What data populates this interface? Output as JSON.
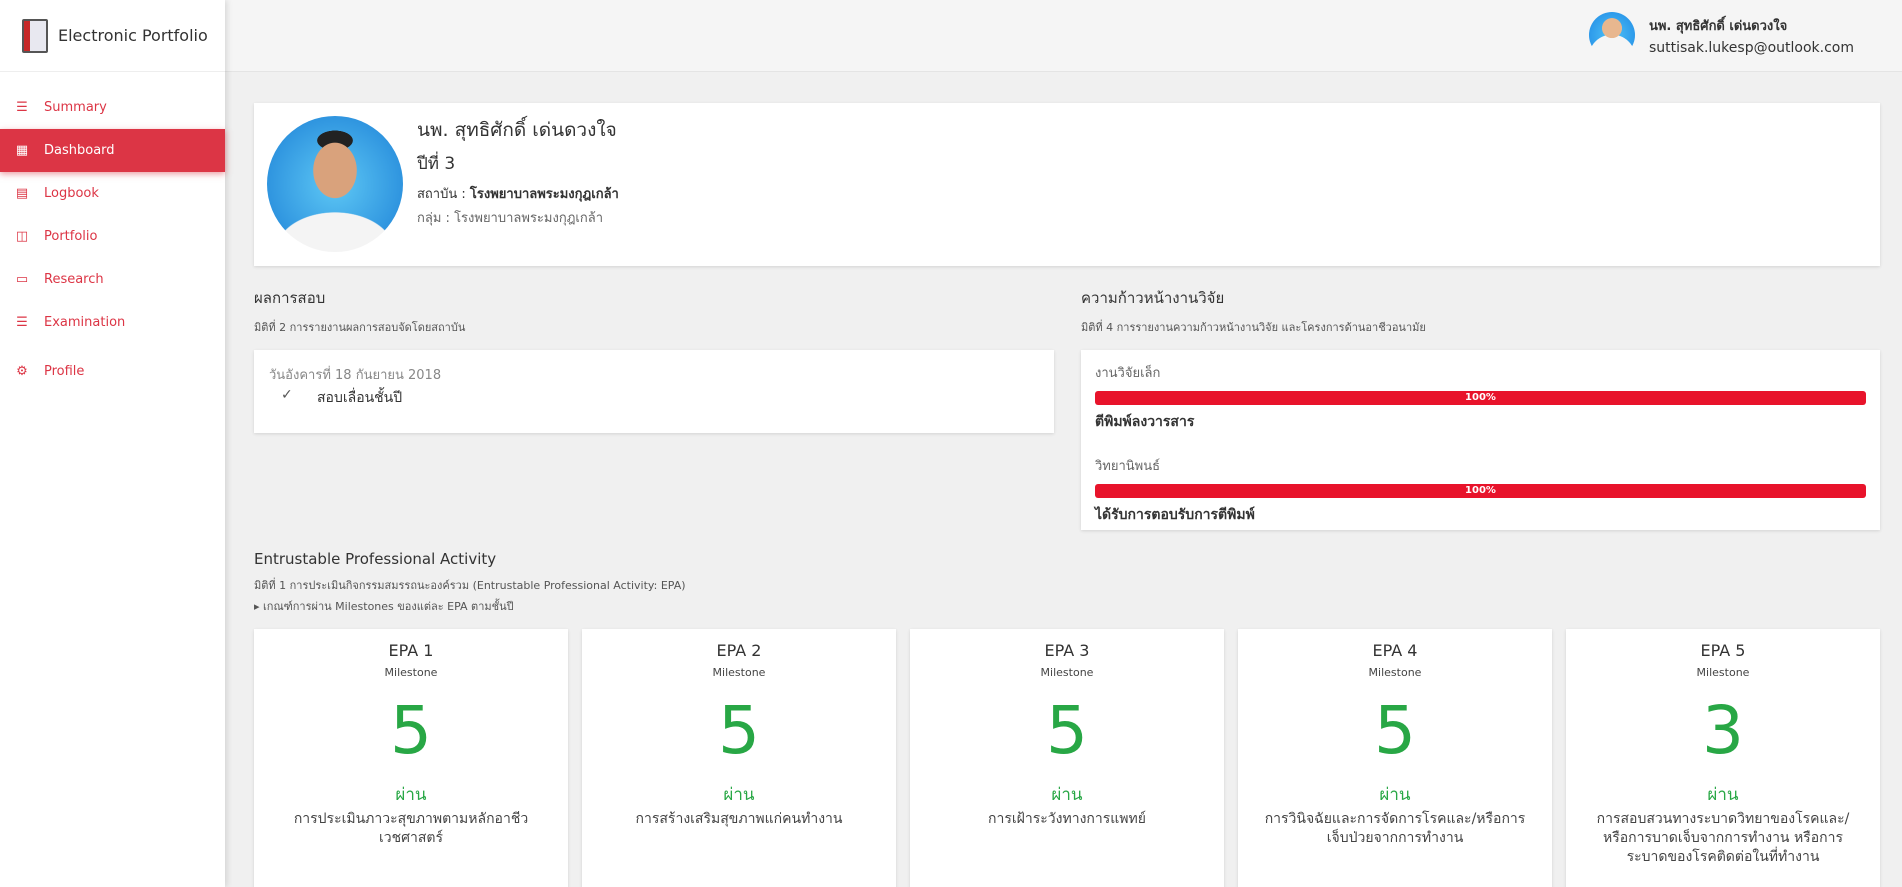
{
  "app": {
    "title": "Electronic Portfolio"
  },
  "sidebar": {
    "items": [
      {
        "label": "Summary",
        "icon": "list-icon"
      },
      {
        "label": "Dashboard",
        "icon": "dashboard-icon"
      },
      {
        "label": "Logbook",
        "icon": "book-icon"
      },
      {
        "label": "Portfolio",
        "icon": "portfolio-icon"
      },
      {
        "label": "Research",
        "icon": "research-icon"
      },
      {
        "label": "Examination",
        "icon": "list-icon"
      },
      {
        "label": "Profile",
        "icon": "gear-icon"
      }
    ],
    "active": "Dashboard"
  },
  "header": {
    "user_name": "นพ. สุทธิศักดิ์ เด่นดวงใจ",
    "user_email": "suttisak.lukesp@outlook.com"
  },
  "profile": {
    "name": "นพ. สุทธิศักดิ์ เด่นดวงใจ",
    "year": "ปีที่ 3",
    "institution_label": "สถาบัน : ",
    "institution": "โรงพยาบาลพระมงกุฎเกล้า",
    "group_label": "กลุ่ม : ",
    "group": "โรงพยาบาลพระมงกุฎเกล้า"
  },
  "exam": {
    "title": "ผลการสอบ",
    "subtitle": "มิติที่ 2 การรายงานผลการสอบจัดโดยสถาบัน",
    "date": "วันอังคารที่ 18 กันยายน 2018",
    "item": "สอบเลื่อนชั้นปี"
  },
  "research": {
    "title": "ความก้าวหน้างานวิจัย",
    "subtitle": "มิติที่ 4 การรายงานความก้าวหน้างานวิจัย และโครงการด้านอาชีวอนามัย",
    "blocks": [
      {
        "label": "งานวิจัยเล็ก",
        "percent": 100,
        "percent_text": "100%",
        "status": "ตีพิมพ์ลงวารสาร"
      },
      {
        "label": "วิทยานิพนธ์",
        "percent": 100,
        "percent_text": "100%",
        "status": "ได้รับการตอบรับการตีพิมพ์"
      }
    ]
  },
  "epa": {
    "title": "Entrustable Professional Activity",
    "subtitle": "มิติที่ 1 การประเมินกิจกรรมสมรรถนะองค์รวม (Entrustable Professional Activity: EPA)",
    "criteria": "▸ เกณฑ์การผ่าน Milestones ของแต่ละ EPA ตามชั้นปี",
    "cards": [
      {
        "title": "EPA 1",
        "label": "Milestone",
        "value": "5",
        "status": "ผ่าน",
        "desc": "การประเมินภาวะสุขภาพตามหลักอาชีวเวชศาสตร์"
      },
      {
        "title": "EPA 2",
        "label": "Milestone",
        "value": "5",
        "status": "ผ่าน",
        "desc": "การสร้างเสริมสุขภาพแก่คนทำงาน"
      },
      {
        "title": "EPA 3",
        "label": "Milestone",
        "value": "5",
        "status": "ผ่าน",
        "desc": "การเฝ้าระวังทางการแพทย์"
      },
      {
        "title": "EPA 4",
        "label": "Milestone",
        "value": "5",
        "status": "ผ่าน",
        "desc": "การวินิจฉัยและการจัดการโรคและ/หรือการเจ็บป่วยจากการทำงาน"
      },
      {
        "title": "EPA 5",
        "label": "Milestone",
        "value": "3",
        "status": "ผ่าน",
        "desc": "การสอบสวนทางระบาดวิทยาของโรคและ/หรือการบาดเจ็บจากการทำงาน หรือการระบาดของโรคติดต่อในที่ทำงาน"
      }
    ]
  },
  "colors": {
    "accent": "#dc3545",
    "progress": "#e8132b",
    "pass": "#28a745"
  }
}
